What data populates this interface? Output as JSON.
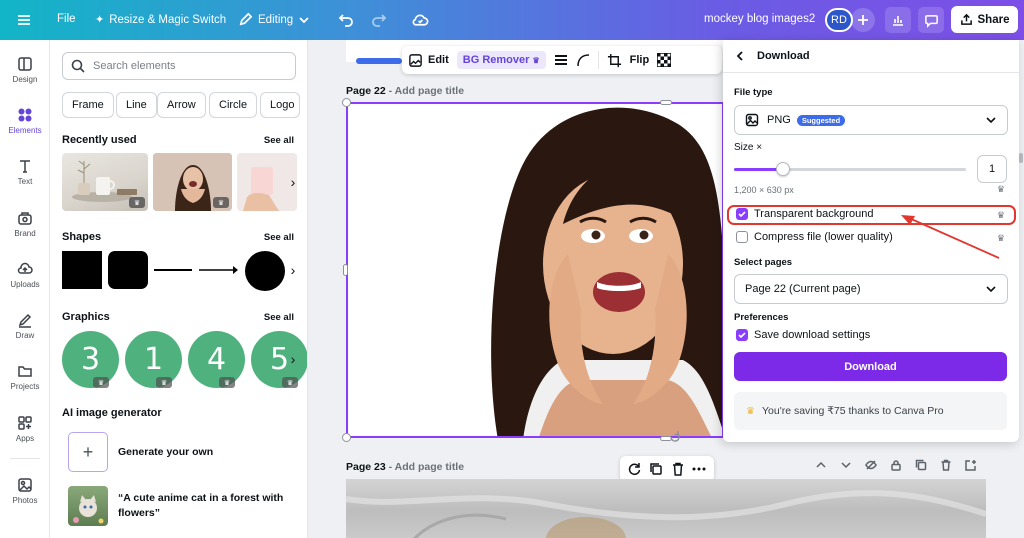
{
  "topbar": {
    "file": "File",
    "resize": "Resize & Magic Switch",
    "editing": "Editing",
    "doc_title": "mockey blog images2",
    "avatar": "RD",
    "share": "Share"
  },
  "rail": {
    "items": [
      {
        "label": "Design",
        "icon": "design-icon"
      },
      {
        "label": "Elements",
        "icon": "elements-icon"
      },
      {
        "label": "Text",
        "icon": "text-icon"
      },
      {
        "label": "Brand",
        "icon": "brand-icon"
      },
      {
        "label": "Uploads",
        "icon": "uploads-icon"
      },
      {
        "label": "Draw",
        "icon": "draw-icon"
      },
      {
        "label": "Projects",
        "icon": "projects-icon"
      },
      {
        "label": "Apps",
        "icon": "apps-icon"
      },
      {
        "label": "Photos",
        "icon": "photos-icon"
      }
    ]
  },
  "elements_panel": {
    "search_placeholder": "Search elements",
    "chips": [
      "Frame",
      "Line",
      "Arrow",
      "Circle",
      "Logo"
    ],
    "recently_used": "Recently used",
    "shapes": "Shapes",
    "graphics": "Graphics",
    "see_all": "See all",
    "graphics_numbers": [
      "3",
      "1",
      "4",
      "5"
    ],
    "ai_title": "AI image generator",
    "generate_own": "Generate your own",
    "cat_prompt_line1": "“A cute anime cat in a forest with",
    "cat_prompt_line2": "flowers”"
  },
  "canvas": {
    "toolbar": {
      "edit": "Edit",
      "bg_remover": "BG Remover",
      "flip": "Flip"
    },
    "page22_label": "Page 22",
    "page23_label": "Page 23",
    "add_title": "- Add page title"
  },
  "download": {
    "title": "Download",
    "file_type_label": "File type",
    "file_type": "PNG",
    "suggested": "Suggested",
    "size_label": "Size ×",
    "size_value": "1",
    "size_fraction": 0.21,
    "dimensions": "1,200 × 630 px",
    "transparent_bg": "Transparent background",
    "compress": "Compress file (lower quality)",
    "select_pages_label": "Select pages",
    "pages_value": "Page 22 (Current page)",
    "preferences_label": "Preferences",
    "save_settings": "Save download settings",
    "download_button": "Download",
    "saving_note": "You're saving ₹75 thanks to Canva Pro"
  },
  "colors": {
    "accent": "#8b3dff",
    "download_button": "#7d2ae8",
    "highlight": "#e0382f",
    "graphics_green": "#4fb27e"
  }
}
